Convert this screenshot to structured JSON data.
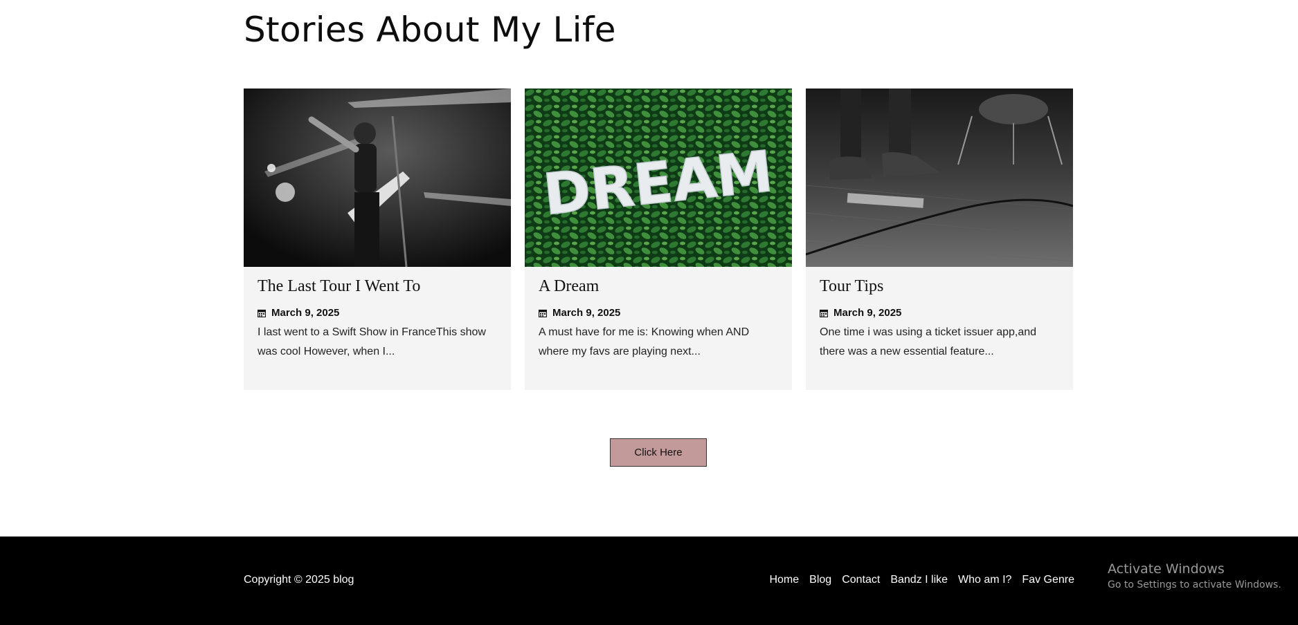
{
  "section": {
    "title": "Stories About My Life"
  },
  "posts": [
    {
      "title": "The Last Tour I Went To",
      "date": "March 9, 2025",
      "excerpt": "I last went to a Swift Show in FranceThis show was cool However, when I..."
    },
    {
      "title": "A Dream",
      "date": "March 9, 2025",
      "excerpt": "A must have for me is: Knowing when AND where my favs are playing next...",
      "image_text": "DREAM"
    },
    {
      "title": "Tour Tips",
      "date": "March 9, 2025",
      "excerpt": "One time i was using a ticket issuer app,and there was a new essential feature..."
    }
  ],
  "cta": {
    "label": "Click Here",
    "color": "#c39a9a"
  },
  "footer": {
    "copyright": "Copyright © 2025 blog",
    "links": [
      "Home",
      "Blog",
      "Contact",
      "Bandz I like",
      "Who am I?",
      "Fav Genre"
    ]
  },
  "watermark": {
    "title": "Activate Windows",
    "subtitle": "Go to Settings to activate Windows."
  }
}
